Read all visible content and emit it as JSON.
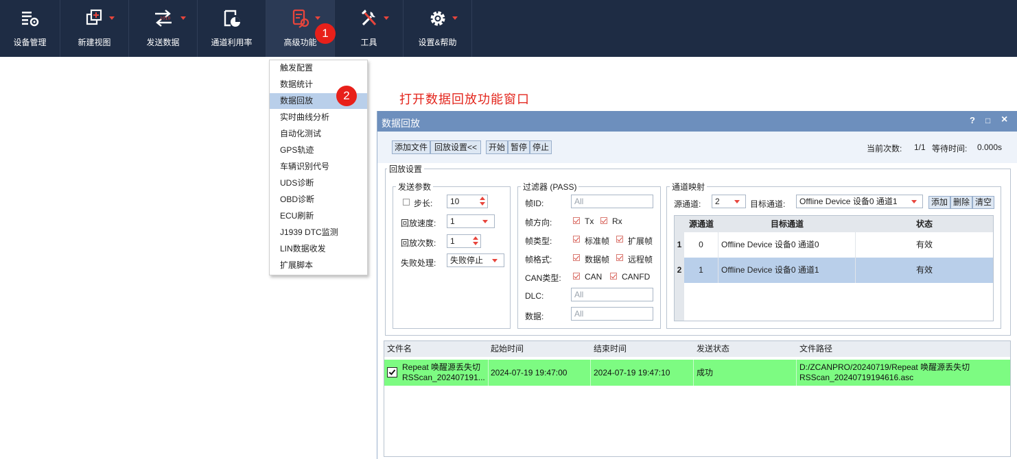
{
  "toolbar": {
    "items": [
      {
        "label": "设备管理",
        "icon": "device-management-icon"
      },
      {
        "label": "新建视图",
        "icon": "new-view-icon"
      },
      {
        "label": "发送数据",
        "icon": "send-data-icon"
      },
      {
        "label": "通道利用率",
        "icon": "channel-usage-icon"
      },
      {
        "label": "高级功能",
        "icon": "advanced-functions-icon"
      },
      {
        "label": "工具",
        "icon": "tools-icon"
      },
      {
        "label": "设置&帮助",
        "icon": "settings-help-icon"
      }
    ]
  },
  "badges": {
    "one": "1",
    "two": "2"
  },
  "menu": {
    "items": [
      "触发配置",
      "数据统计",
      "数据回放",
      "实时曲线分析",
      "自动化测试",
      "GPS轨迹",
      "车辆识别代号",
      "UDS诊断",
      "OBD诊断",
      "ECU刷新",
      "J1939 DTC监测",
      "LIN数据收发",
      "扩展脚本"
    ],
    "selected": "数据回放"
  },
  "annotation": "打开数据回放功能窗口",
  "window": {
    "title": "数据回放",
    "controls": {
      "help": "?",
      "maximize": "□",
      "close": "×"
    },
    "buttons": {
      "add_file": "添加文件",
      "playback_settings": "回放设置<<",
      "start": "开始",
      "pause": "暂停",
      "stop": "停止"
    },
    "status": {
      "count_label": "当前次数:",
      "count_value": "1/1",
      "wait_label": "等待时间:",
      "wait_value": "0.000s"
    },
    "settings": {
      "title": "回放设置",
      "send_params": {
        "title": "发送参数",
        "step_label": "步长:",
        "step_value": "10",
        "step_checked": false,
        "speed_label": "回放速度:",
        "speed_value": "1",
        "times_label": "回放次数:",
        "times_value": "1",
        "fail_label": "失败处理:",
        "fail_value": "失败停止"
      },
      "filter": {
        "title": "过滤器 (PASS)",
        "frame_id_label": "帧ID:",
        "frame_id_placeholder": "All",
        "direction_label": "帧方向:",
        "tx": "Tx",
        "rx": "Rx",
        "type_label": "帧类型:",
        "standard": "标准帧",
        "extended": "扩展帧",
        "format_label": "帧格式:",
        "data_frame": "数据帧",
        "remote_frame": "远程帧",
        "can_type_label": "CAN类型:",
        "can": "CAN",
        "canfd": "CANFD",
        "dlc_label": "DLC:",
        "dlc_placeholder": "All",
        "data_label": "数据:",
        "data_placeholder": "All"
      },
      "mapping": {
        "title": "通道映射",
        "source_label": "源通道:",
        "source_value": "2",
        "target_label": "目标通道:",
        "target_value": "Offline Device 设备0 通道1",
        "add": "添加",
        "delete": "删除",
        "clear": "清空",
        "columns": {
          "source": "源通道",
          "target": "目标通道",
          "state": "状态"
        },
        "rows": [
          {
            "idx": "1",
            "source": "0",
            "target": "Offline Device 设备0 通道0",
            "state": "有效"
          },
          {
            "idx": "2",
            "source": "1",
            "target": "Offline Device 设备0 通道1",
            "state": "有效"
          }
        ]
      }
    },
    "files": {
      "columns": {
        "name": "文件名",
        "start": "起始时间",
        "end": "结束时间",
        "status": "发送状态",
        "path": "文件路径"
      },
      "rows": [
        {
          "checked": true,
          "name_line1": "Repeat 唤醒源丢失切",
          "name_line2": "RSScan_202407191...",
          "start": "2024-07-19 19:47:00",
          "end": "2024-07-19 19:47:10",
          "status": "成功",
          "path_line1": "D:/ZCANPRO/20240719/Repeat 唤醒源丢失切",
          "path_line2": "RSScan_20240719194616.asc"
        }
      ]
    }
  },
  "colors": {
    "toolbar_bg": "#1e2c44",
    "accent": "#e8453c",
    "title_bar": "#6d8fbd",
    "row_success": "#7dfb82",
    "row_selected": "#b9cfea"
  }
}
